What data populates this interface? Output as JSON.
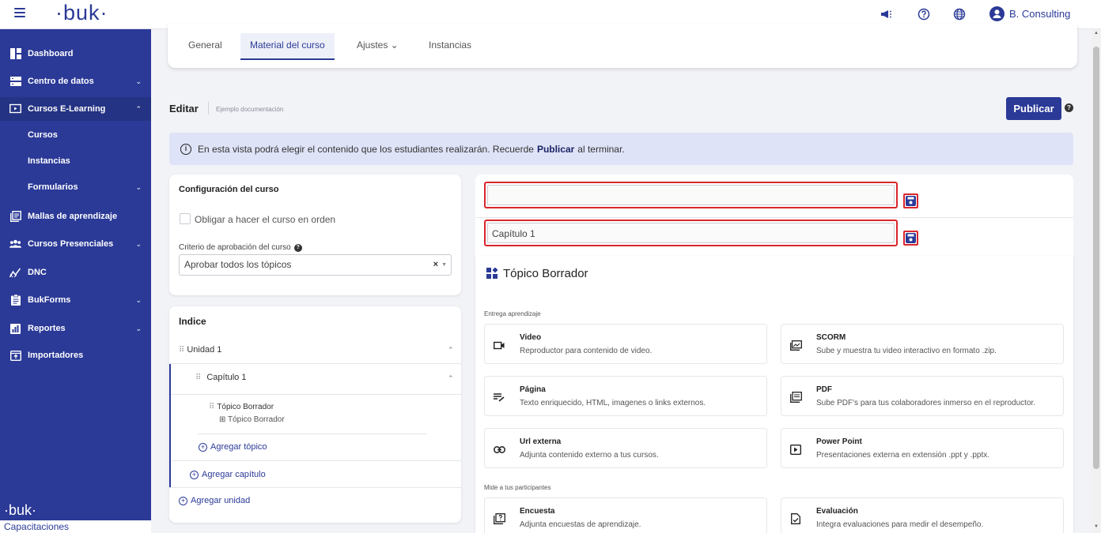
{
  "topbar": {
    "logo": "·buk·",
    "user_name": "B. Consulting"
  },
  "sidebar": {
    "items": [
      {
        "label": "Dashboard"
      },
      {
        "label": "Centro de datos"
      },
      {
        "label": "Cursos E-Learning"
      },
      {
        "label": "Mallas de aprendizaje"
      },
      {
        "label": "Cursos Presenciales"
      },
      {
        "label": "DNC"
      },
      {
        "label": "BukForms"
      },
      {
        "label": "Reportes"
      },
      {
        "label": "Importadores"
      }
    ],
    "subitems": [
      {
        "label": "Cursos"
      },
      {
        "label": "Instancias"
      },
      {
        "label": "Formularios"
      }
    ],
    "footer_logo": "·buk·",
    "footer_label": "Capacitaciones"
  },
  "tabs": [
    {
      "label": "General"
    },
    {
      "label": "Material del curso"
    },
    {
      "label": "Ajustes ⌄"
    },
    {
      "label": "Instancias"
    }
  ],
  "edit": {
    "title": "Editar",
    "subtitle": "Ejemplo documentación",
    "publish_label": "Publicar"
  },
  "banner": {
    "text_before": "En esta vista podrá elegir el contenido que los estudiantes realizarán. Recuerde",
    "bold": "Publicar",
    "text_after": "al terminar."
  },
  "config": {
    "title": "Configuración del curso",
    "checkbox_label": "Obligar a hacer el curso en orden",
    "criteria_label": "Criterio de aprobación del curso",
    "criteria_value": "Aprobar todos los tópicos"
  },
  "index": {
    "title": "Indice",
    "unit": "Unidad 1",
    "chapter": "Capítulo 1",
    "topic_name": "Tópico Borrador",
    "topic_type": "Tópico Borrador",
    "add_topic": "Agregar tópico",
    "add_chapter": "Agregar capítulo",
    "add_unit": "Agregar unidad"
  },
  "editor": {
    "unit_input_value": "",
    "chapter_input_value": "Capítulo 1",
    "topic_title": "Tópico Borrador",
    "section_delivery": "Entrega aprendizaje",
    "section_measure": "Mide a tus participantes",
    "tiles": [
      {
        "title": "Video",
        "desc": "Reproductor para contenido de video.",
        "icon": "video-icon"
      },
      {
        "title": "SCORM",
        "desc": "Sube y muestra tu video interactivo en formato .zip.",
        "icon": "scorm-icon"
      },
      {
        "title": "Página",
        "desc": "Texto enriquecido, HTML, imagenes o links externos.",
        "icon": "page-icon"
      },
      {
        "title": "PDF",
        "desc": "Sube PDF's para tus colaboradores inmerso en el reproductor.",
        "icon": "pdf-icon"
      },
      {
        "title": "Url externa",
        "desc": "Adjunta contenido externo a tus cursos.",
        "icon": "link-icon"
      },
      {
        "title": "Power Point",
        "desc": "Presentaciones externa en extensión .ppt y .pptx.",
        "icon": "powerpoint-icon"
      },
      {
        "title": "Encuesta",
        "desc": "Adjunta encuestas de aprendizaje.",
        "icon": "survey-icon"
      },
      {
        "title": "Evaluación",
        "desc": "Integra evaluaciones para medir el desempeño.",
        "icon": "evaluation-icon"
      }
    ]
  },
  "colors": {
    "brand": "#2b3a97",
    "highlight": "#d9262c"
  }
}
